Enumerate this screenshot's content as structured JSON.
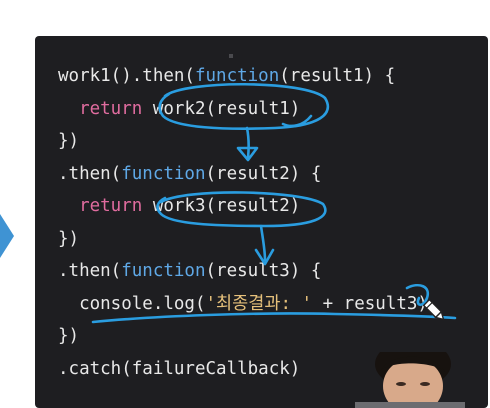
{
  "code": {
    "line1": {
      "a": "work1().then(",
      "b": "function",
      "c": "(result1) {"
    },
    "line2": {
      "indent": "  ",
      "a": "return",
      "b": " work2(result1)"
    },
    "line3": {
      "a": "})"
    },
    "line4": {
      "a": ".then(",
      "b": "function",
      "c": "(result2) {"
    },
    "line5": {
      "indent": "  ",
      "a": "return",
      "b": " work3(result2)"
    },
    "line6": {
      "a": "})"
    },
    "line7": {
      "a": ".then(",
      "b": "function",
      "c": "(result3) {"
    },
    "line8": {
      "indent": "  ",
      "a": "console.log(",
      "b": "'최종결과: '",
      "c": " + result3)"
    },
    "line9": {
      "a": "})"
    },
    "line10": {
      "a": ".catch(failureCallback)"
    }
  },
  "colors": {
    "slide_bg": "#1e1e21",
    "keyword": "#e06c9f",
    "function_keyword": "#5fa8e6",
    "string": "#e5c07b",
    "annotation_ink": "#2a9de0",
    "nav_arrow": "#3f93d3"
  },
  "icons": {
    "nav": "play-arrow-icon",
    "pen": "pencil-icon"
  }
}
